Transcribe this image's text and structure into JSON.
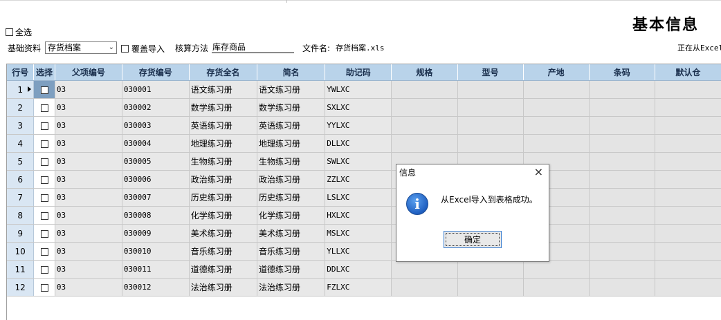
{
  "page": {
    "title": "基本信息"
  },
  "select_all": {
    "label": "全选",
    "checked": false
  },
  "toolbar": {
    "base_label": "基础资料",
    "base_value": "存货档案",
    "overwrite_label": "覆盖导入",
    "method_label": "核算方法",
    "method_value": "库存商品",
    "file_label": "文件名:",
    "file_value": "存货档案.xls",
    "status_text": "正在从Excel"
  },
  "grid": {
    "headers": [
      "行号",
      "选择",
      "父项编号",
      "存货编号",
      "存货全名",
      "简名",
      "助记码",
      "规格",
      "型号",
      "产地",
      "条码",
      "默认仓"
    ],
    "rows": [
      {
        "num": "1",
        "parent": "03",
        "code": "030001",
        "name": "语文练习册",
        "short": "语文练习册",
        "mnemonic": "YWLXC"
      },
      {
        "num": "2",
        "parent": "03",
        "code": "030002",
        "name": "数学练习册",
        "short": "数学练习册",
        "mnemonic": "SXLXC"
      },
      {
        "num": "3",
        "parent": "03",
        "code": "030003",
        "name": "英语练习册",
        "short": "英语练习册",
        "mnemonic": "YYLXC"
      },
      {
        "num": "4",
        "parent": "03",
        "code": "030004",
        "name": "地理练习册",
        "short": "地理练习册",
        "mnemonic": "DLLXC"
      },
      {
        "num": "5",
        "parent": "03",
        "code": "030005",
        "name": "生物练习册",
        "short": "生物练习册",
        "mnemonic": "SWLXC"
      },
      {
        "num": "6",
        "parent": "03",
        "code": "030006",
        "name": "政治练习册",
        "short": "政治练习册",
        "mnemonic": "ZZLXC"
      },
      {
        "num": "7",
        "parent": "03",
        "code": "030007",
        "name": "历史练习册",
        "short": "历史练习册",
        "mnemonic": "LSLXC"
      },
      {
        "num": "8",
        "parent": "03",
        "code": "030008",
        "name": "化学练习册",
        "short": "化学练习册",
        "mnemonic": "HXLXC"
      },
      {
        "num": "9",
        "parent": "03",
        "code": "030009",
        "name": "美术练习册",
        "short": "美术练习册",
        "mnemonic": "MSLXC"
      },
      {
        "num": "10",
        "parent": "03",
        "code": "030010",
        "name": "音乐练习册",
        "short": "音乐练习册",
        "mnemonic": "YLLXC"
      },
      {
        "num": "11",
        "parent": "03",
        "code": "030011",
        "name": "道德练习册",
        "short": "道德练习册",
        "mnemonic": "DDLXC"
      },
      {
        "num": "12",
        "parent": "03",
        "code": "030012",
        "name": "法治练习册",
        "short": "法治练习册",
        "mnemonic": "FZLXC"
      }
    ]
  },
  "dialog": {
    "title": "信息",
    "close_glyph": "×",
    "message": "从Excel导入到表格成功。",
    "ok_label": "确定",
    "icon_glyph": "i"
  }
}
